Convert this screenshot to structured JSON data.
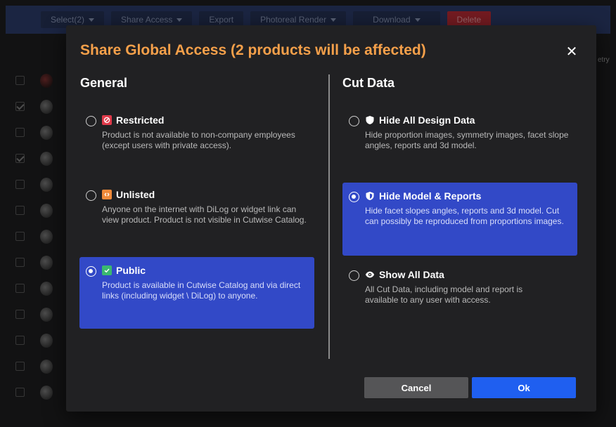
{
  "background": {
    "toolbar": {
      "select_label": "Select(2)",
      "share_label": "Share Access",
      "export_label": "Export",
      "render_label": "Photoreal Render",
      "download_label": "Download",
      "delete_label": "Delete"
    },
    "column_label": "etry"
  },
  "modal": {
    "title": "Share Global Access (2 products will be affected)",
    "close_symbol": "✕",
    "general": {
      "heading": "General",
      "options": [
        {
          "title": "Restricted",
          "icon": "restricted-icon",
          "color": "#e03a4a",
          "description": "Product is not available to non-company employees (except users with private access).",
          "selected": false
        },
        {
          "title": "Unlisted",
          "icon": "unlisted-icon",
          "color": "#f08a3a",
          "description": "Anyone on the internet with DiLog or widget link can view product. Product is not visible in Cutwise Catalog.",
          "selected": false
        },
        {
          "title": "Public",
          "icon": "public-check-icon",
          "color": "#3ab870",
          "description": "Product is available in Cutwise Catalog and via direct links (including widget \\ DiLog) to anyone.",
          "selected": true
        }
      ]
    },
    "cut_data": {
      "heading": "Cut Data",
      "options": [
        {
          "title": "Hide All Design Data",
          "icon": "shield-icon",
          "description": "Hide proportion images, symmetry images, facet slope angles, reports and 3d model.",
          "selected": false
        },
        {
          "title": "Hide Model & Reports",
          "icon": "half-shield-icon",
          "description": "Hide facet slopes angles, reports and 3d model. Cut can possibly be reproduced from proportions images.",
          "selected": true
        },
        {
          "title": "Show All Data",
          "icon": "eye-icon",
          "description": "All Cut Data, including model and report is available to any user with access.",
          "selected": false
        }
      ]
    },
    "buttons": {
      "cancel_label": "Cancel",
      "ok_label": "Ok"
    }
  },
  "colors": {
    "title_accent": "#f5a04a",
    "selected_bg": "#3249c7",
    "ok_button": "#1f5ff0",
    "cancel_button": "#555557"
  }
}
